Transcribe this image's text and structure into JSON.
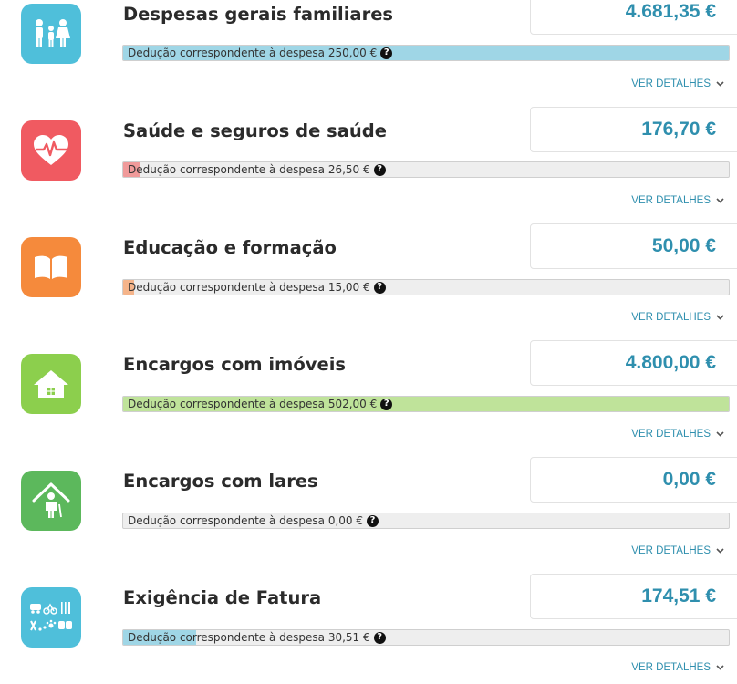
{
  "colors": {
    "accent": "#2f8fae",
    "familia": "#4fbfda",
    "saude": "#f05a61",
    "educacao": "#f58a3c",
    "imoveis": "#8ccf4d",
    "lares": "#5cb85c",
    "fatura": "#4fbfda"
  },
  "details_label": "VER DETALHES",
  "categories": [
    {
      "icon": "family-icon",
      "title": "Despesas gerais familiares",
      "amount": "4.681,35 €",
      "deduction_label": "Dedução correspondente à despesa 250,00 €",
      "fill_fraction": 1.0,
      "fill_color": "#9fd6e6"
    },
    {
      "icon": "heart-pulse-icon",
      "title": "Saúde e seguros de saúde",
      "amount": "176,70 €",
      "deduction_label": "Dedução correspondente à despesa 26,50 €",
      "fill_fraction": 0.027,
      "fill_color": "#f09a9a"
    },
    {
      "icon": "book-icon",
      "title": "Educação e formação",
      "amount": "50,00 €",
      "deduction_label": "Dedução correspondente à despesa 15,00 €",
      "fill_fraction": 0.018,
      "fill_color": "#f5b48a"
    },
    {
      "icon": "house-icon",
      "title": "Encargos com imóveis",
      "amount": "4.800,00 €",
      "deduction_label": "Dedução correspondente à despesa 502,00 €",
      "fill_fraction": 1.0,
      "fill_color": "#bfe39a"
    },
    {
      "icon": "elderly-home-icon",
      "title": "Encargos com lares",
      "amount": "0,00 €",
      "deduction_label": "Dedução correspondente à despesa 0,00 €",
      "fill_fraction": 0.0,
      "fill_color": "#bfe39a"
    },
    {
      "icon": "invoice-sectors-icon",
      "title": "Exigência de Fatura",
      "amount": "174,51 €",
      "deduction_label": "Dedução correspondente à despesa 30,51 €",
      "fill_fraction": 0.12,
      "fill_color": "#9fd6e6"
    }
  ]
}
